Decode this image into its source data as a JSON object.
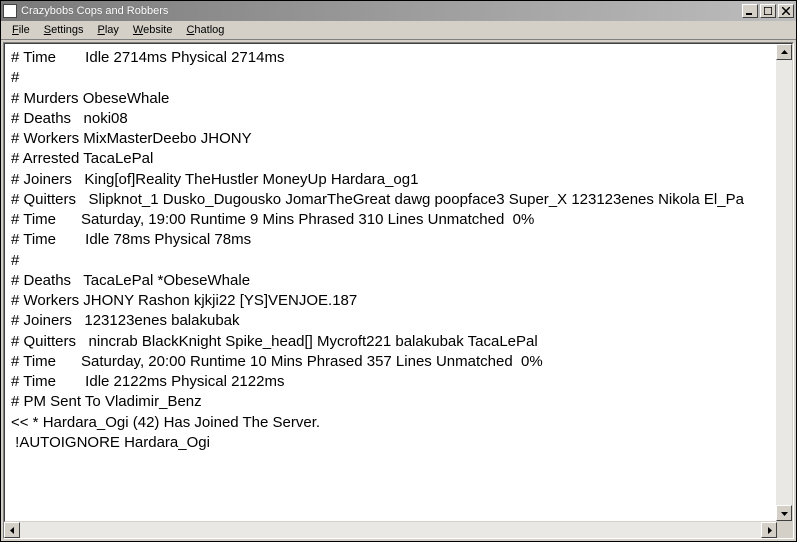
{
  "window": {
    "title": "Crazybobs Cops and Robbers"
  },
  "menu": {
    "items": [
      {
        "label": "File",
        "accel": "F"
      },
      {
        "label": "Settings",
        "accel": "S"
      },
      {
        "label": "Play",
        "accel": "P"
      },
      {
        "label": "Website",
        "accel": "W"
      },
      {
        "label": "Chatlog",
        "accel": "C"
      }
    ]
  },
  "log": {
    "lines": [
      "# Time       Idle 2714ms Physical 2714ms",
      "#",
      "# Murders ObeseWhale",
      "# Deaths   noki08",
      "# Workers MixMasterDeebo JHONY",
      "# Arrested TacaLePal",
      "# Joiners   King[of]Reality TheHustler MoneyUp Hardara_og1",
      "# Quitters   Slipknot_1 Dusko_Dugousko JomarTheGreat dawg poopface3 Super_X 123123enes Nikola El_Pa",
      "# Time      Saturday, 19:00 Runtime 9 Mins Phrased 310 Lines Unmatched  0%",
      "# Time       Idle 78ms Physical 78ms",
      "#",
      "# Deaths   TacaLePal *ObeseWhale",
      "# Workers JHONY Rashon kjkji22 [YS]VENJOE.187",
      "# Joiners   123123enes balakubak",
      "# Quitters   nincrab BlackKnight Spike_head[] Mycroft221 balakubak TacaLePal",
      "# Time      Saturday, 20:00 Runtime 10 Mins Phrased 357 Lines Unmatched  0%",
      "# Time       Idle 2122ms Physical 2122ms",
      "# PM Sent To Vladimir_Benz",
      "<< * Hardara_Ogi (42) Has Joined The Server.",
      " !AUTOIGNORE Hardara_Ogi"
    ]
  }
}
